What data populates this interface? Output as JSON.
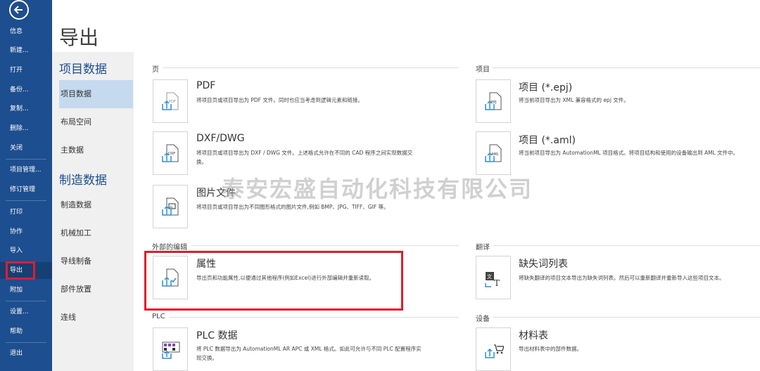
{
  "rail": {
    "items": [
      {
        "label": "信息",
        "active": false
      },
      {
        "label": "新建...",
        "active": false
      },
      {
        "label": "打开",
        "active": false
      },
      {
        "label": "备份...",
        "active": false
      },
      {
        "label": "复制...",
        "active": false
      },
      {
        "label": "删除...",
        "active": false
      },
      {
        "label": "关闭",
        "active": false
      },
      {
        "label": "项目管理...",
        "active": false
      },
      {
        "label": "修订管理",
        "active": false
      },
      {
        "label": "打印",
        "active": false
      },
      {
        "label": "协作",
        "active": false
      },
      {
        "label": "导入",
        "active": false
      },
      {
        "label": "导出",
        "active": true
      },
      {
        "label": "附加",
        "active": false
      },
      {
        "label": "设置...",
        "active": false
      },
      {
        "label": "帮助",
        "active": false
      },
      {
        "label": "退出",
        "active": false
      }
    ]
  },
  "page": {
    "title": "导出"
  },
  "categories": {
    "group1_title": "项目数据",
    "group1_items": [
      "项目数据",
      "布局空间",
      "主数据"
    ],
    "group2_title": "制造数据",
    "group2_items": [
      "制造数据",
      "机械加工",
      "导线制备",
      "部件放置",
      "连线"
    ]
  },
  "sections": {
    "page": {
      "heading": "页",
      "cards": [
        {
          "title": "PDF",
          "desc": "将项目页或项目导出为 PDF 文件。同时也应当考虑到逻辑元素和链接。",
          "icon_name": "pdf-export-icon",
          "icon_label": "PDF"
        },
        {
          "title": "DXF/DWG",
          "desc": "将项目页或项目导出为 DXF / DWG 文件。上述格式允许在不同的 CAD 程序之间实现数据交换。",
          "icon_name": "dxf-export-icon",
          "icon_label": "DXF"
        },
        {
          "title": "图片文件",
          "desc": "将项目页或项目导出为不同图形格式的图片文件,例如 BMP、JPG、TIFF、GIF 等。",
          "icon_name": "image-export-icon",
          "icon_label": ""
        }
      ]
    },
    "project": {
      "heading": "项目",
      "cards": [
        {
          "title": "项目 (*.epj)",
          "desc": "将当前项目导出为 XML 兼容格式的 epj 文件。",
          "icon_name": "epj-export-icon",
          "icon_label": "EPJ"
        },
        {
          "title": "项目 (*.aml)",
          "desc": "将当前项目导出为 AutomationML 项目格式。将项目结构和使用的设备输出到 AML 文件中。",
          "icon_name": "aml-export-icon",
          "icon_label": "AML"
        }
      ]
    },
    "external": {
      "heading": "外部的编辑",
      "cards": [
        {
          "title": "属性",
          "desc": "导出页和功能属性,以便通过其他程序(例如Excel)进行外部编辑并重新读取。",
          "icon_name": "properties-export-icon",
          "icon_label": ""
        }
      ]
    },
    "translation": {
      "heading": "翻译",
      "cards": [
        {
          "title": "缺失词列表",
          "desc": "将缺失翻译的项目文本导出为缺失词列表。然后可以重新翻译并重新导入这些项目文本。",
          "icon_name": "missing-words-icon",
          "icon_label": ""
        }
      ]
    },
    "plc": {
      "heading": "PLC",
      "cards": [
        {
          "title": "PLC 数据",
          "desc": "将 PLC 数据导出为 AutomationML AR APC 或 XML 格式。如此可允许与不同 PLC 配置程序实现交换。",
          "icon_name": "plc-export-icon",
          "icon_label": ""
        }
      ]
    },
    "devices": {
      "heading": "设备",
      "cards": [
        {
          "title": "材料表",
          "desc": "导出材料表中的部件数据。",
          "icon_name": "bom-export-icon",
          "icon_label": ""
        }
      ]
    }
  },
  "watermark": "泰安宏盛自动化科技有限公司",
  "colors": {
    "rail": "#1d4e8f",
    "accent": "#1d4e8f",
    "highlight": "#e11d2a",
    "icon_arrow": "#2a8fd6"
  }
}
